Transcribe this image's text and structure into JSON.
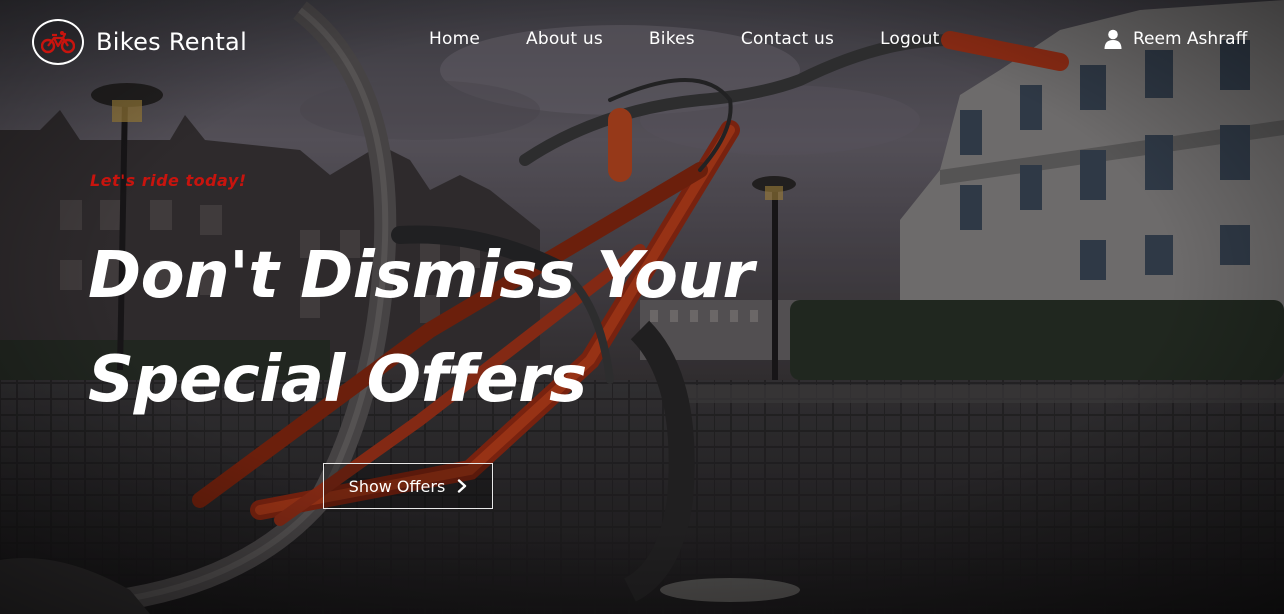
{
  "brand": {
    "name": "Bikes Rental",
    "logo_icon": "bicycle-icon",
    "accent_color": "#c8140e"
  },
  "nav": {
    "items": [
      {
        "label": "Home"
      },
      {
        "label": "About us"
      },
      {
        "label": "Bikes"
      },
      {
        "label": "Contact us"
      },
      {
        "label": "Logout"
      }
    ]
  },
  "user": {
    "name": "Reem Ashraff",
    "icon": "user-icon"
  },
  "hero": {
    "tagline": "Let's ride today!",
    "headline_line1": "Don't Dismiss Your",
    "headline_line2": "Special Offers",
    "cta_label": "Show Offers",
    "cta_icon": "chevron-right-icon",
    "background": "photo of a red bicycle on a cobblestone street at dusk"
  }
}
